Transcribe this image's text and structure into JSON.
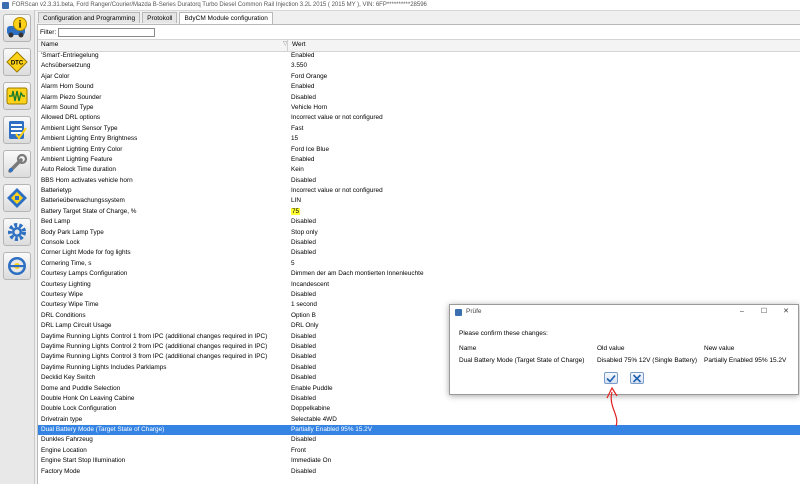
{
  "window": {
    "title": "FORScan v2.3.31.beta, Ford Ranger/Courier/Mazda B-Series Duratorq Turbo Diesel Common Rail Injection 3.2L 2015 ( 2015 MY ), VIN: 6FP**********28596"
  },
  "sidebar": {
    "items": [
      {
        "icon": "info-icon"
      },
      {
        "icon": "dtc-icon"
      },
      {
        "icon": "oscilloscope-icon"
      },
      {
        "icon": "checklist-icon"
      },
      {
        "icon": "wrench-icon"
      },
      {
        "icon": "chip-icon"
      },
      {
        "icon": "gear-icon"
      },
      {
        "icon": "steering-wheel-icon"
      }
    ]
  },
  "tabs": [
    {
      "label": "Configuration and Programming"
    },
    {
      "label": "Protokoll"
    },
    {
      "label": "BdyCM Module configuration"
    }
  ],
  "filter": {
    "label": "Filter:",
    "value": ""
  },
  "grid": {
    "col_name": "Name",
    "col_value": "Wert",
    "rows": [
      {
        "name": "'Smart'-Entriegelung",
        "value": "Enabled"
      },
      {
        "name": "Achsübersetzung",
        "value": "3.550"
      },
      {
        "name": "Ajar Color",
        "value": "Ford Orange"
      },
      {
        "name": "Alarm Horn Sound",
        "value": "Enabled"
      },
      {
        "name": "Alarm Piezo Sounder",
        "value": "Disabled"
      },
      {
        "name": "Alarm Sound Type",
        "value": "Vehicle Horn"
      },
      {
        "name": "Allowed DRL options",
        "value": "Incorrect value or not configured"
      },
      {
        "name": "Ambient Light Sensor Type",
        "value": "Fast"
      },
      {
        "name": "Ambient Lighting Entry Brightness",
        "value": "15"
      },
      {
        "name": "Ambient Lighting Entry Color",
        "value": "Ford Ice Blue"
      },
      {
        "name": "Ambient Lighting Feature",
        "value": "Enabled"
      },
      {
        "name": "Auto Relock Time duration",
        "value": "Kein"
      },
      {
        "name": "BBS Horn activates vehicle horn",
        "value": "Disabled"
      },
      {
        "name": "Batterietyp",
        "value": "Incorrect value or not configured"
      },
      {
        "name": "Batterieüberwachungssystem",
        "value": "LIN"
      },
      {
        "name": "Battery Target State of Charge, %",
        "value": "75",
        "highlight": true
      },
      {
        "name": "Bed Lamp",
        "value": "Disabled"
      },
      {
        "name": "Body Park Lamp Type",
        "value": "Stop only"
      },
      {
        "name": "Console Lock",
        "value": "Disabled"
      },
      {
        "name": "Corner Light Mode for fog lights",
        "value": "Disabled"
      },
      {
        "name": "Cornering Time, s",
        "value": "5"
      },
      {
        "name": "Courtesy Lamps Configuration",
        "value": "Dimmen der am Dach montierten Innenleuchte"
      },
      {
        "name": "Courtesy Lighting",
        "value": "Incandescent"
      },
      {
        "name": "Courtesy Wipe",
        "value": "Disabled"
      },
      {
        "name": "Courtesy Wipe Time",
        "value": "1 second"
      },
      {
        "name": "DRL Conditions",
        "value": "Option B"
      },
      {
        "name": "DRL Lamp Circuit Usage",
        "value": "DRL Only"
      },
      {
        "name": "Daytime Running Lights Control 1 from IPC (additional changes required in IPC)",
        "value": "Disabled"
      },
      {
        "name": "Daytime Running Lights Control 2 from IPC (additional changes required in IPC)",
        "value": "Disabled"
      },
      {
        "name": "Daytime Running Lights Control 3 from IPC (additional changes required in IPC)",
        "value": "Disabled"
      },
      {
        "name": "Daytime Running Lights Includes Parklamps",
        "value": "Disabled"
      },
      {
        "name": "Decklid Key Switch",
        "value": "Disabled"
      },
      {
        "name": "Dome and Puddle Selection",
        "value": "Enable Puddle"
      },
      {
        "name": "Double Honk On Leaving Cabine",
        "value": "Disabled"
      },
      {
        "name": "Double Lock Configuration",
        "value": "Doppelkabine"
      },
      {
        "name": "Drivetrain type",
        "value": "Selectable 4WD"
      },
      {
        "name": "Dual Battery Mode (Target State of Charge)",
        "value": "Partially Enabled 95% 15.2V",
        "selected": true
      },
      {
        "name": "Dunkles Fahrzeug",
        "value": "Disabled"
      },
      {
        "name": "Engine Location",
        "value": "Front"
      },
      {
        "name": "Engine Start Stop Illumination",
        "value": "Immediate On"
      },
      {
        "name": "Factory Mode",
        "value": "Disabled"
      }
    ]
  },
  "dialog": {
    "title": "Prüfe",
    "message": "Please confirm these changes:",
    "col_name": "Name",
    "col_old": "Old value",
    "col_new": "New value",
    "name": "Dual Battery Mode (Target State of Charge)",
    "old_value": "Disabled 75% 12V (Single Battery)",
    "new_value": "Partially Enabled 95% 15.2V"
  },
  "colors": {
    "selection": "#3584e4",
    "highlight": "#ffff33",
    "annotation_arrow": "#e02020"
  }
}
